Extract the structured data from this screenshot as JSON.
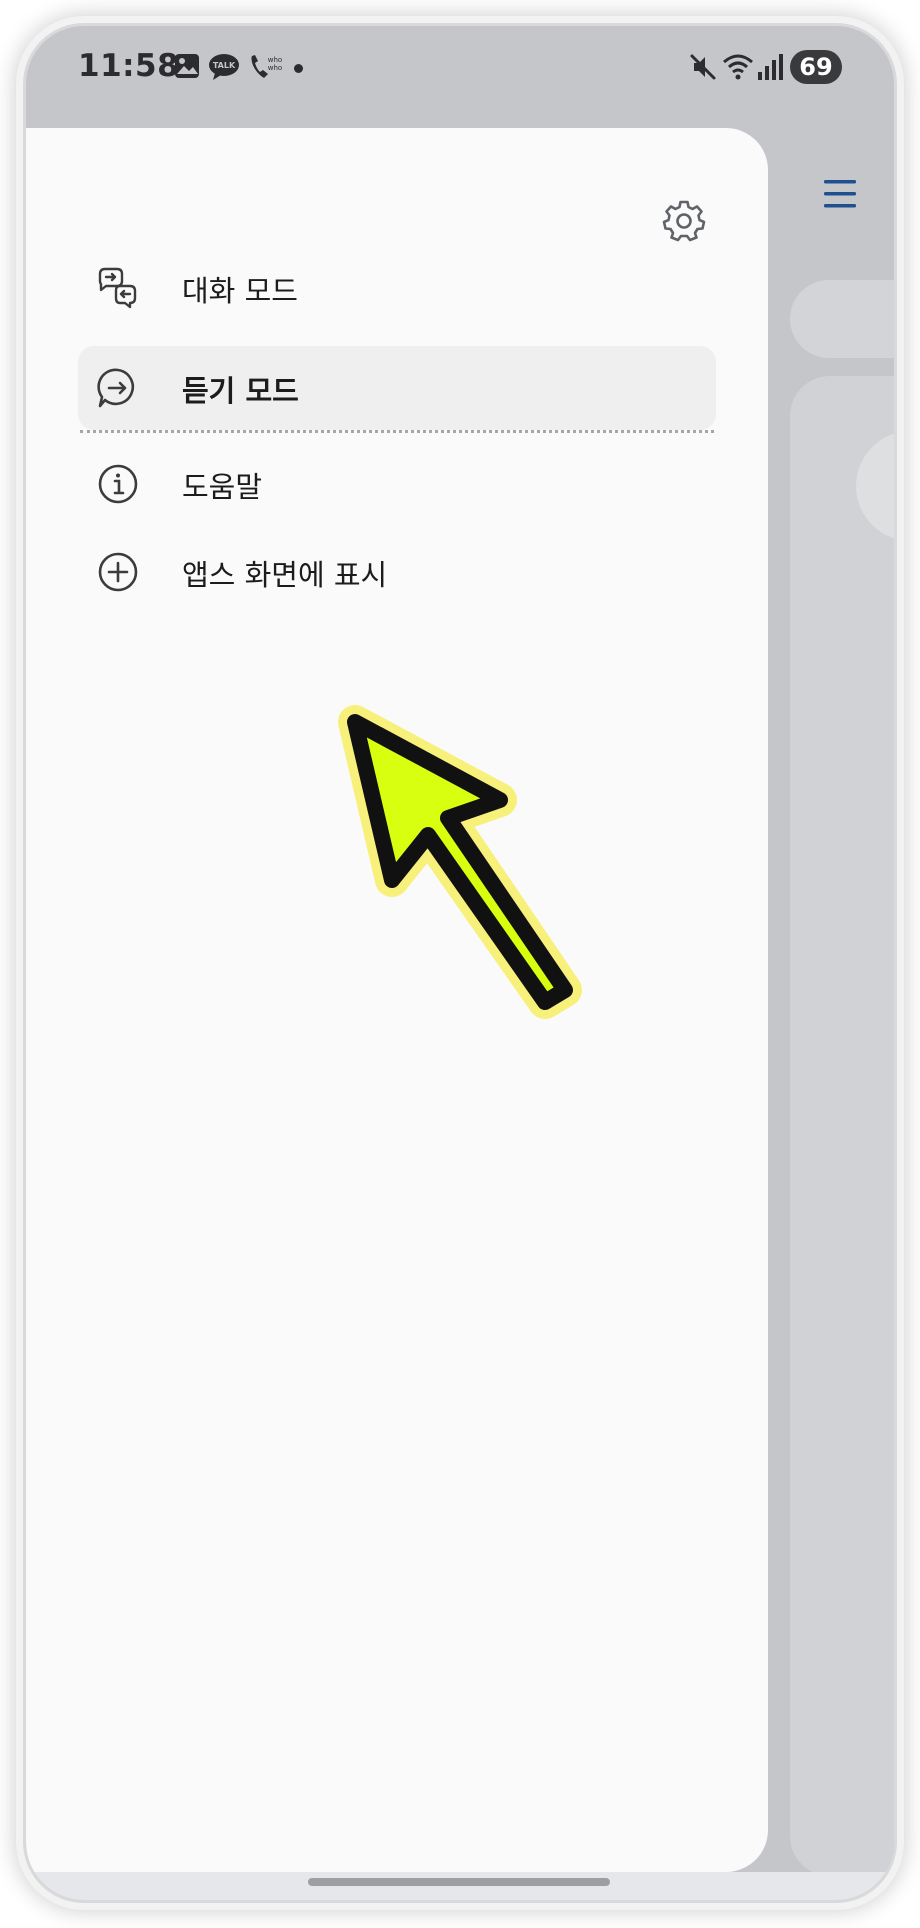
{
  "status_bar": {
    "time": "11:58",
    "battery": "69",
    "icons": [
      "gallery-icon",
      "kakaotalk-icon",
      "whowho-icon",
      "notification-dot",
      "mute-icon",
      "wifi-icon",
      "signal-icon"
    ]
  },
  "drawer": {
    "items": [
      {
        "label": "대화 모드",
        "icon": "conversation-icon",
        "selected": false
      },
      {
        "label": "듣기 모드",
        "icon": "listen-icon",
        "selected": true
      },
      {
        "label": "도움말",
        "icon": "info-icon",
        "selected": false
      },
      {
        "label": "앱스 화면에 표시",
        "icon": "add-circle-icon",
        "selected": false
      }
    ]
  },
  "colors": {
    "drawer_bg": "#fafafa",
    "selected_bg": "#efefef",
    "scrim": "#c5c6ca",
    "menu_icon": "#1f4f8f",
    "annotation_arrow": "#d8ff10"
  }
}
